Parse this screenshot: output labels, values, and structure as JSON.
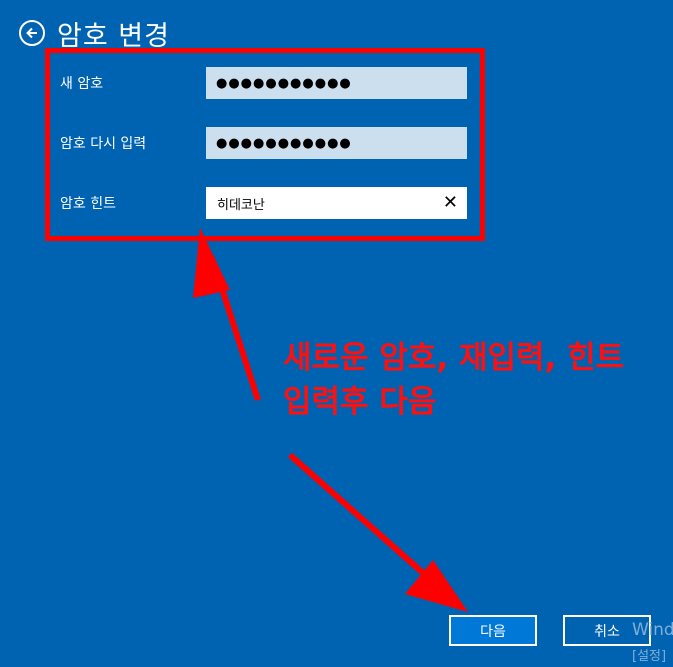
{
  "header": {
    "title": "암호 변경"
  },
  "form": {
    "new_password": {
      "label": "새 암호",
      "value": "●●●●●●●●●●●"
    },
    "confirm_password": {
      "label": "암호 다시 입력",
      "value": "●●●●●●●●●●●"
    },
    "hint": {
      "label": "암호 힌트",
      "value": "히데코난"
    }
  },
  "annotation": {
    "line1": "새로운 암호, 재입력, 힌트",
    "line2": "입력후 다음"
  },
  "buttons": {
    "next": "다음",
    "cancel": "취소"
  },
  "watermark": {
    "line1": "Wind",
    "line2": "[설정]"
  },
  "colors": {
    "background": "#0063b1",
    "annotation": "#ff0000",
    "input": "#ccdfee"
  }
}
